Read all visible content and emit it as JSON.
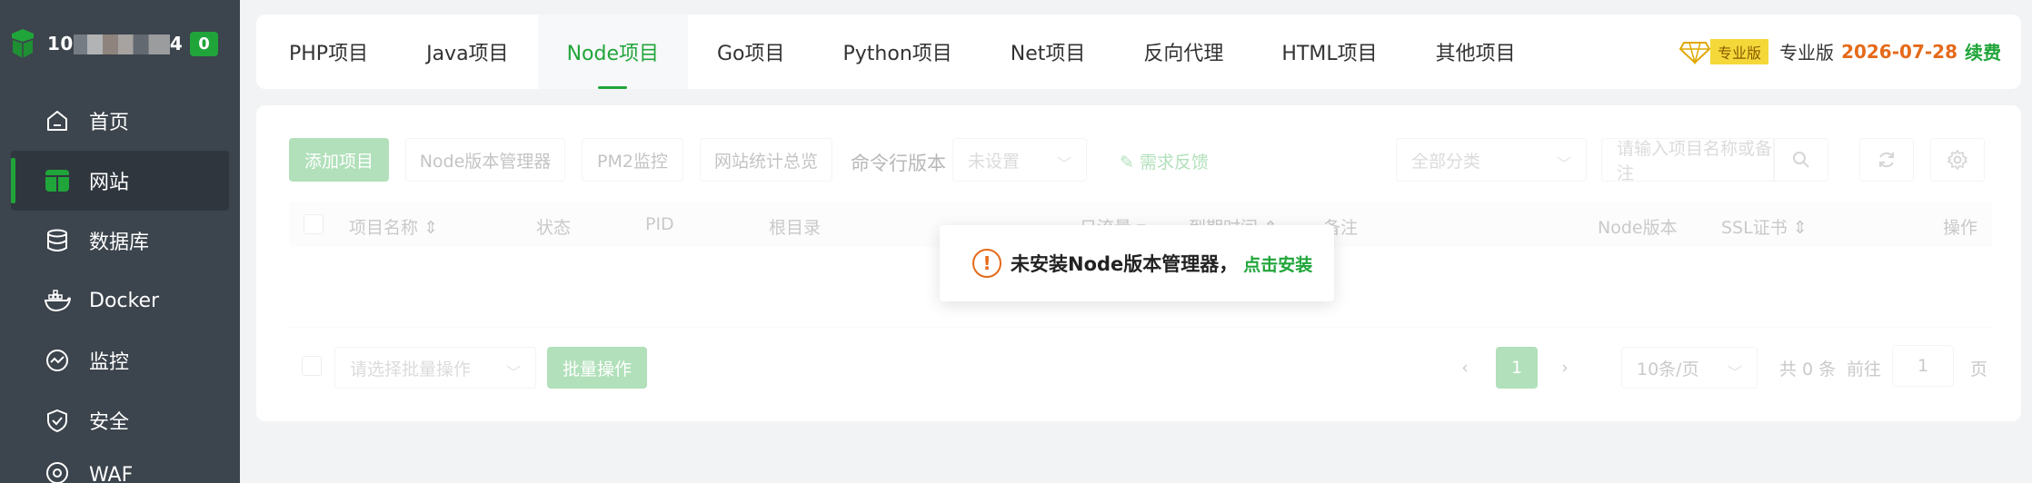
{
  "sidebar": {
    "ip_prefix": "10",
    "ip_suffix": "4",
    "badge": "0",
    "items": [
      {
        "label": "首页",
        "icon": "home-icon"
      },
      {
        "label": "网站",
        "icon": "website-icon",
        "active": true
      },
      {
        "label": "数据库",
        "icon": "database-icon"
      },
      {
        "label": "Docker",
        "icon": "docker-icon"
      },
      {
        "label": "监控",
        "icon": "monitor-icon"
      },
      {
        "label": "安全",
        "icon": "shield-icon"
      },
      {
        "label": "WAF",
        "icon": "waf-icon"
      }
    ]
  },
  "tabs": [
    "PHP项目",
    "Java项目",
    "Node项目",
    "Go项目",
    "Python项目",
    "Net项目",
    "反向代理",
    "HTML项目",
    "其他项目"
  ],
  "active_tab": "Node项目",
  "pro": {
    "tag": "专业版",
    "version": "专业版",
    "expire": "2026-07-28",
    "renew": "续费"
  },
  "toolbar": {
    "add_project": "添加项目",
    "node_manager": "Node版本管理器",
    "pm2": "PM2监控",
    "site_stats": "网站统计总览",
    "cli_version_label": "命令行版本",
    "cli_version_value": "未设置",
    "feedback": "需求反馈",
    "category": "全部分类",
    "search_placeholder": "请输入项目名称或备注"
  },
  "table": {
    "columns": [
      "项目名称",
      "状态",
      "PID",
      "根目录",
      "日流量",
      "到期时间",
      "备注",
      "Node版本",
      "SSL证书",
      "操作"
    ]
  },
  "footer": {
    "batch_placeholder": "请选择批量操作",
    "batch_button": "批量操作",
    "page": "1",
    "page_size": "10条/页",
    "total": "共 0 条",
    "goto_label": "前往",
    "goto_value": "1",
    "page_unit": "页"
  },
  "toast": {
    "message": "未安装Node版本管理器，",
    "action": "点击安装"
  },
  "colors": {
    "accent": "#20a53a",
    "sidebar": "#3c444d",
    "warning": "#e56a1a"
  }
}
